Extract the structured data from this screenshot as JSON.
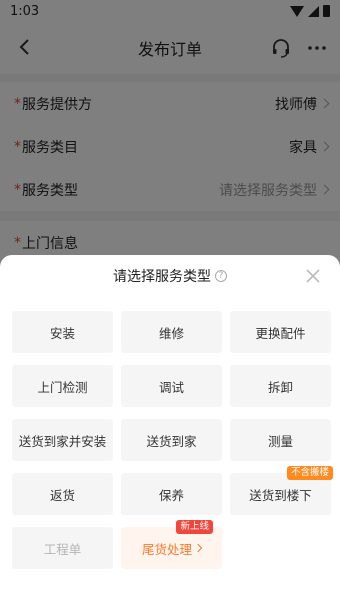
{
  "status_bar": {
    "time": "1:03"
  },
  "nav": {
    "title": "发布订单"
  },
  "form": {
    "rows": [
      {
        "label": "服务提供方",
        "value": "找师傅",
        "required": "*"
      },
      {
        "label": "服务类目",
        "value": "家具",
        "required": "*"
      },
      {
        "label": "服务类型",
        "value": "请选择服务类型",
        "required": "*"
      }
    ],
    "section2_label": "上门信息",
    "section2_required": "*"
  },
  "sheet": {
    "title": "请选择服务类型",
    "help_glyph": "?",
    "options": [
      {
        "label": "安装"
      },
      {
        "label": "维修"
      },
      {
        "label": "更换配件"
      },
      {
        "label": "上门检测"
      },
      {
        "label": "调试"
      },
      {
        "label": "拆卸"
      },
      {
        "label": "送货到家并安装"
      },
      {
        "label": "送货到家"
      },
      {
        "label": "测量"
      },
      {
        "label": "返货"
      },
      {
        "label": "保养"
      },
      {
        "label": "送货到楼下",
        "badge": "不含搬楼"
      },
      {
        "label": "工程单",
        "state": "disabled"
      },
      {
        "label": "尾货处理",
        "badge": "新上线",
        "state": "highlight"
      }
    ]
  },
  "colors": {
    "accent": "#ff7a2a",
    "required": "#e5452b",
    "badge_orange": "#ff8a1e",
    "badge_red": "#f0463c"
  }
}
